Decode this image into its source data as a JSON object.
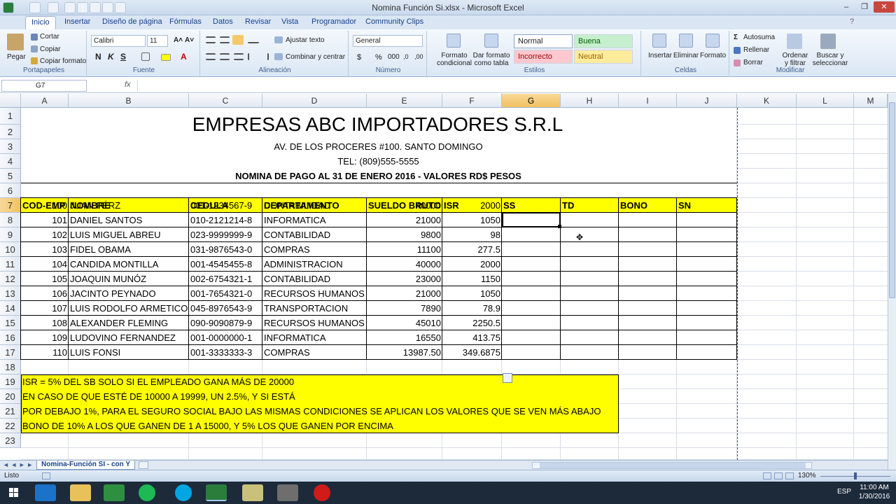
{
  "window": {
    "title": "Nomina Función Si.xlsx - Microsoft Excel"
  },
  "tabs": [
    "Inicio",
    "Insertar",
    "Diseño de página",
    "Fórmulas",
    "Datos",
    "Revisar",
    "Vista",
    "Programador",
    "Community Clips"
  ],
  "ribbon": {
    "clipboard": {
      "paste": "Pegar",
      "cut": "Cortar",
      "copy": "Copiar",
      "format_painter": "Copiar formato",
      "label": "Portapapeles"
    },
    "font": {
      "name": "Calibri",
      "size": "11",
      "bold": "N",
      "italic": "K",
      "underline": "S",
      "label": "Fuente"
    },
    "alignment": {
      "wrap": "Ajustar texto",
      "merge": "Combinar y centrar",
      "label": "Alineación"
    },
    "number": {
      "format": "General",
      "currency": "$",
      "percent": "%",
      "thousands": "000",
      "label": "Número"
    },
    "styles": {
      "conditional": "Formato condicional",
      "table": "Dar formato como tabla",
      "normal": "Normal",
      "good": "Buena",
      "bad": "Incorrecto",
      "neutral": "Neutral",
      "label": "Estilos"
    },
    "cells": {
      "insert": "Insertar",
      "delete": "Eliminar",
      "format": "Formato",
      "label": "Celdas"
    },
    "editing": {
      "autosum": "Autosuma",
      "fill": "Rellenar",
      "clear": "Borrar",
      "sort": "Ordenar y filtrar",
      "find": "Buscar y seleccionar",
      "label": "Modificar"
    }
  },
  "formula_bar": {
    "name_box": "G7",
    "fx": "fx",
    "value": ""
  },
  "columns": [
    "A",
    "B",
    "C",
    "D",
    "E",
    "F",
    "G",
    "H",
    "I",
    "J",
    "K",
    "L",
    "M"
  ],
  "rows": [
    "1",
    "2",
    "3",
    "4",
    "5",
    "6",
    "7",
    "8",
    "9",
    "10",
    "11",
    "12",
    "13",
    "14",
    "15",
    "16",
    "17",
    "18",
    "19",
    "20",
    "21",
    "22",
    "23"
  ],
  "sheet": {
    "title": "EMPRESAS ABC IMPORTADORES S.R.L",
    "address": "AV. DE LOS PROCERES #100. SANTO DOMINGO",
    "phone": "TEL: (809)555-5555",
    "subtitle": "NOMINA DE PAGO AL 31 DE ENERO 2016  - VALORES RD$ PESOS",
    "headers": [
      "COD-EMP",
      "NOMBRE",
      "CEDULA",
      "DEPARTAMENTO",
      "SUELDO BRUTO",
      "ISR",
      "SS",
      "TD",
      "BONO",
      "SN"
    ],
    "data": [
      [
        "100",
        "JUAN PÉRZ",
        "001-1234567-9",
        "CONTABILIDAD",
        "40000",
        "2000"
      ],
      [
        "101",
        "DANIEL SANTOS",
        "010-2121214-8",
        "INFORMATICA",
        "21000",
        "1050"
      ],
      [
        "102",
        "LUIS MIGUEL ABREU",
        "023-9999999-9",
        "CONTABILIDAD",
        "9800",
        "98"
      ],
      [
        "103",
        "FIDEL OBAMA",
        "031-9876543-0",
        "COMPRAS",
        "11100",
        "277.5"
      ],
      [
        "104",
        "CANDIDA MONTILLA",
        "001-4545455-8",
        "ADMINISTRACION",
        "40000",
        "2000"
      ],
      [
        "105",
        "JOAQUIN MUNÓZ",
        "002-6754321-1",
        "CONTABILIDAD",
        "23000",
        "1150"
      ],
      [
        "106",
        "JACINTO PEYNADO",
        "001-7654321-0",
        "RECURSOS HUMANOS",
        "21000",
        "1050"
      ],
      [
        "107",
        "LUIS RODOLFO ARMETICO",
        "045-8976543-9",
        "TRANSPORTACION",
        "7890",
        "78.9"
      ],
      [
        "108",
        "ALEXANDER FLEMING",
        "090-9090879-9",
        "RECURSOS HUMANOS",
        "45010",
        "2250.5"
      ],
      [
        "109",
        "LUDOVINO FERNANDEZ",
        "001-0000000-1",
        "INFORMATICA",
        "16550",
        "413.75"
      ],
      [
        "110",
        "LUIS FONSI",
        "001-3333333-3",
        "COMPRAS",
        "13987.50",
        "349.6875"
      ]
    ],
    "notes": [
      "ISR = 5% DEL SB SOLO SI EL EMPLEADO GANA MÁS DE 20000",
      "EN CASO DE QUE ESTÉ DE 10000 A 19999, UN 2.5%, Y SI ESTÁ",
      "POR DEBAJO 1%, PARA EL SEGURO SOCIAL BAJO LAS MISMAS CONDICIONES SE APLICAN LOS VALORES QUE SE VEN MÁS ABAJO",
      "BONO DE 10% A LOS QUE GANEN DE 1 A 15000, Y 5% LOS QUE GANEN POR ENCIMA"
    ]
  },
  "sheet_tab": "Nomina-Función SI - con Y",
  "status": {
    "ready": "Listo",
    "zoom": "130%"
  },
  "taskbar": {
    "lang": "ESP",
    "time": "11:00 AM",
    "date": "1/30/2016"
  },
  "colors": {
    "yellow": "#ffff00",
    "selection": "#f1c15f",
    "ribbon": "#dbe7f5"
  }
}
